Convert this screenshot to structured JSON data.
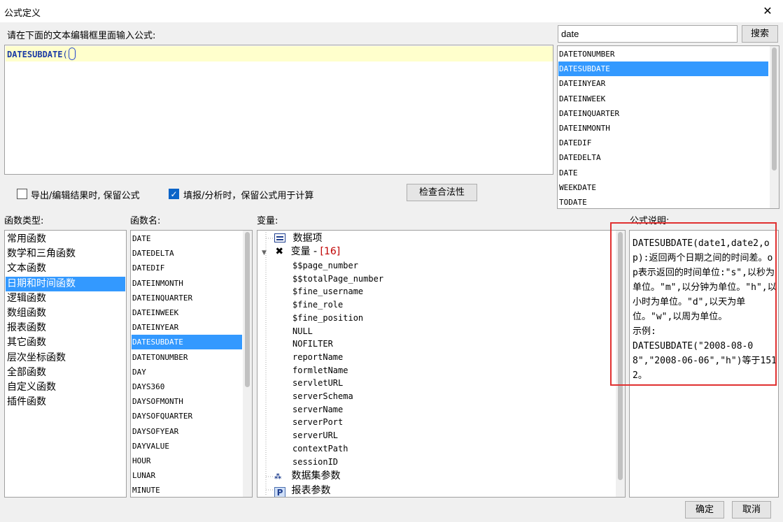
{
  "window": {
    "title": "公式定义",
    "close": "✕"
  },
  "editor": {
    "prompt": "请在下面的文本编辑框里面输入公式:",
    "formula_name": "DATESUBDATE",
    "formula_open": "("
  },
  "search": {
    "value": "date",
    "button": "搜索"
  },
  "search_results": {
    "items": [
      "DATETONUMBER",
      "DATESUBDATE",
      "DATEINYEAR",
      "DATEINWEEK",
      "DATEINQUARTER",
      "DATEINMONTH",
      "DATEDIF",
      "DATEDELTA",
      "DATE",
      "WEEKDATE",
      "TODATE"
    ],
    "selected_index": 1
  },
  "options": {
    "export_keep_label": "导出/编辑结果时, 保留公式",
    "export_keep_checked": false,
    "fill_keep_label": "填报/分析时，保留公式用于计算",
    "fill_keep_checked": true,
    "check_button": "检查合法性"
  },
  "categories": {
    "header": "函数类型:",
    "items": [
      "常用函数",
      "数学和三角函数",
      "文本函数",
      "日期和时间函数",
      "逻辑函数",
      "数组函数",
      "报表函数",
      "其它函数",
      "层次坐标函数",
      "全部函数",
      "自定义函数",
      "插件函数"
    ],
    "selected_index": 3
  },
  "functions": {
    "header": "函数名:",
    "items": [
      "DATE",
      "DATEDELTA",
      "DATEDIF",
      "DATEINMONTH",
      "DATEINQUARTER",
      "DATEINWEEK",
      "DATEINYEAR",
      "DATESUBDATE",
      "DATETONUMBER",
      "DAY",
      "DAYS360",
      "DAYSOFMONTH",
      "DAYSOFQUARTER",
      "DAYSOFYEAR",
      "DAYVALUE",
      "HOUR",
      "LUNAR",
      "MINUTE"
    ],
    "selected_index": 7
  },
  "variables": {
    "header": "变量:",
    "data_item": "数据项",
    "var_group": "变量 - ",
    "var_count": "[16]",
    "items": [
      "$$page_number",
      "$$totalPage_number",
      "$fine_username",
      "$fine_role",
      "$fine_position",
      "NULL",
      "NOFILTER",
      "reportName",
      "formletName",
      "servletURL",
      "serverSchema",
      "serverName",
      "serverPort",
      "serverURL",
      "contextPath",
      "sessionID"
    ],
    "dataset_params": "数据集参数",
    "report_params": "报表参数"
  },
  "description": {
    "header": "公式说明:",
    "text": "DATESUBDATE(date1,date2,op):返回两个日期之间的时间差。op表示返回的时间单位:\"s\",以秒为单位。\"m\",以分钟为单位。\"h\",以小时为单位。\"d\",以天为单位。\"w\",以周为单位。\n示例:\nDATESUBDATE(\"2008-08-08\",\"2008-06-06\",\"h\")等于1512。"
  },
  "footer": {
    "ok": "确定",
    "cancel": "取消"
  },
  "colors": {
    "selection": "#3399ff",
    "editor_line": "#ffffcc",
    "highlight_border": "#e03030",
    "formula_text": "#1a3aa6"
  }
}
